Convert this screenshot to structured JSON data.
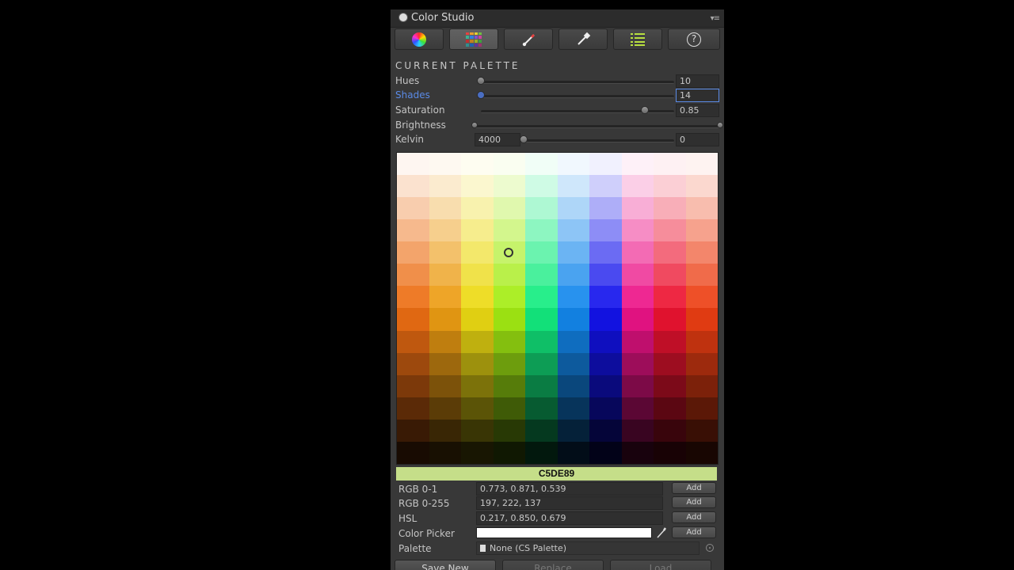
{
  "window": {
    "title": "Color Studio",
    "menu_glyph": "▾≡"
  },
  "toolbar": {
    "tabs": [
      {
        "name": "color-wheel-tab",
        "icon": "color-wheel-icon"
      },
      {
        "name": "palette-grid-tab",
        "icon": "palette-grid-icon",
        "active": true
      },
      {
        "name": "brush-tab",
        "icon": "brush-icon"
      },
      {
        "name": "eyedropper-tab",
        "icon": "eyedropper-icon"
      },
      {
        "name": "list-tab",
        "icon": "list-icon"
      },
      {
        "name": "help-tab",
        "icon": "help-icon",
        "glyph": "?"
      }
    ]
  },
  "palette": {
    "section_title": "CURRENT PALETTE",
    "hues": {
      "label": "Hues",
      "value": "10"
    },
    "shades": {
      "label": "Shades",
      "value": "14"
    },
    "saturation": {
      "label": "Saturation",
      "value": "0.85"
    },
    "brightness": {
      "label": "Brightness"
    },
    "kelvin": {
      "label": "Kelvin",
      "min_value": "4000",
      "value": "0"
    }
  },
  "sliders": {
    "hues_fraction": 0.0,
    "shades_fraction": 0.0,
    "saturation_fraction": 0.85,
    "brightness_low": 0.0,
    "brightness_high": 1.0,
    "kelvin_fraction": 0.0
  },
  "grid": {
    "hues": [
      25,
      38,
      55,
      80,
      150,
      208,
      240,
      328,
      352,
      12
    ],
    "shades": 14,
    "saturation": 0.85,
    "selected": {
      "column": 3,
      "row": 4
    }
  },
  "selected_color": {
    "hex": "C5DE89",
    "hex_color": "#c5de89",
    "rows": [
      {
        "label": "RGB 0-1",
        "value": "0.773, 0.871, 0.539",
        "button": "Add"
      },
      {
        "label": "RGB 0-255",
        "value": "197, 222, 137",
        "button": "Add"
      },
      {
        "label": "HSL",
        "value": "0.217, 0.850, 0.679",
        "button": "Add"
      }
    ],
    "color_picker": {
      "label": "Color Picker",
      "value": "#ffffff",
      "button": "Add"
    },
    "palette": {
      "label": "Palette",
      "value": "None (CS Palette)"
    }
  },
  "bottom_buttons": {
    "save_new": "Save New",
    "replace": "Replace",
    "load": "Load"
  }
}
